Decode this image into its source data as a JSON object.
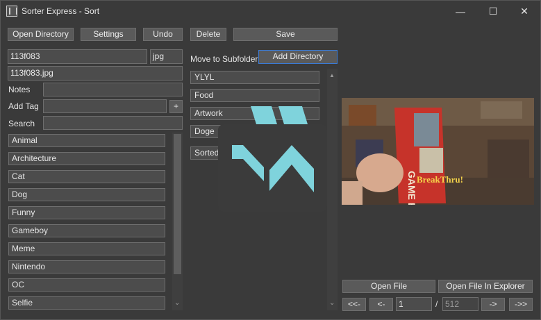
{
  "window": {
    "title": "Sorter Express - Sort",
    "minimize": "—",
    "maximize": "☐",
    "close": "✕"
  },
  "toolbar": {
    "open_directory": "Open Directory",
    "settings": "Settings",
    "undo": "Undo",
    "delete": "Delete",
    "save": "Save"
  },
  "file": {
    "name": "113f083",
    "extension": "jpg",
    "fullname": "113f083.jpg"
  },
  "labels": {
    "notes": "Notes",
    "add_tag": "Add Tag",
    "search": "Search",
    "move_to_subfolder": "Move to Subfolder"
  },
  "buttons": {
    "add_tag_plus": "+",
    "add_directory": "Add Directory",
    "open_file": "Open File",
    "open_file_in_explorer": "Open File In Explorer",
    "first": "<<-",
    "prev": "<-",
    "next": "->",
    "last": "->>"
  },
  "tags": [
    "Animal",
    "Architecture",
    "Cat",
    "Dog",
    "Funny",
    "Gameboy",
    "Meme",
    "Nintendo",
    "OC",
    "Selfie"
  ],
  "folders": [
    "YLYL",
    "Food",
    "Artwork",
    "Doge",
    "Sorted"
  ],
  "pager": {
    "current": "1",
    "separator": "/",
    "total": "512"
  },
  "preview": {
    "box_brand": "GAME BOY",
    "box_title": "BreakThru!"
  },
  "colors": {
    "background": "#3a3a3a",
    "accent": "#7fd3dc",
    "focus_border": "#3b7bd6"
  },
  "icons": {
    "scroll_up": "▲",
    "scroll_down": "⌄"
  }
}
